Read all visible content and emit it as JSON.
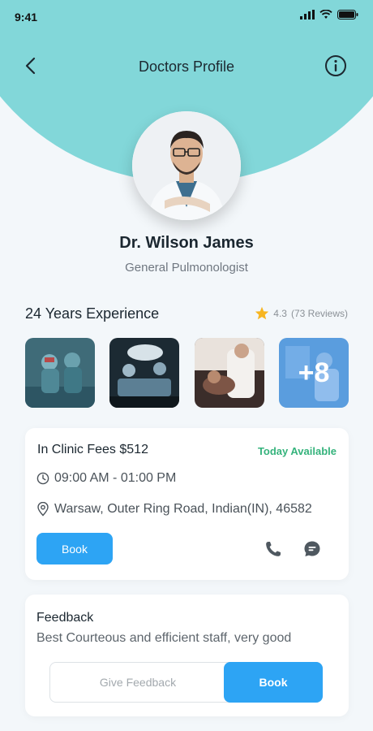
{
  "status": {
    "time": "9:41"
  },
  "nav": {
    "title": "Doctors Profile"
  },
  "doctor": {
    "name": "Dr. Wilson James",
    "role": "General Pulmonologist"
  },
  "experience": {
    "title": "24 Years Experience",
    "rating": "4.3",
    "reviews": "(73 Reviews)"
  },
  "gallery": {
    "more_label": "+8"
  },
  "clinic": {
    "fees": "In Clinic Fees $512",
    "availability": "Today Available",
    "hours": "09:00 AM - 01:00 PM",
    "address": "Warsaw, Outer Ring Road, Indian(IN), 46582",
    "book_label": "Book"
  },
  "feedback": {
    "title": "Feedback",
    "text": "Best Courteous and efficient staff, very good",
    "give_label": "Give Feedback",
    "book_label": "Book"
  },
  "colors": {
    "accent": "#2da4f4",
    "header": "#82d7d9",
    "available": "#35b37c",
    "star": "#f7b521"
  }
}
